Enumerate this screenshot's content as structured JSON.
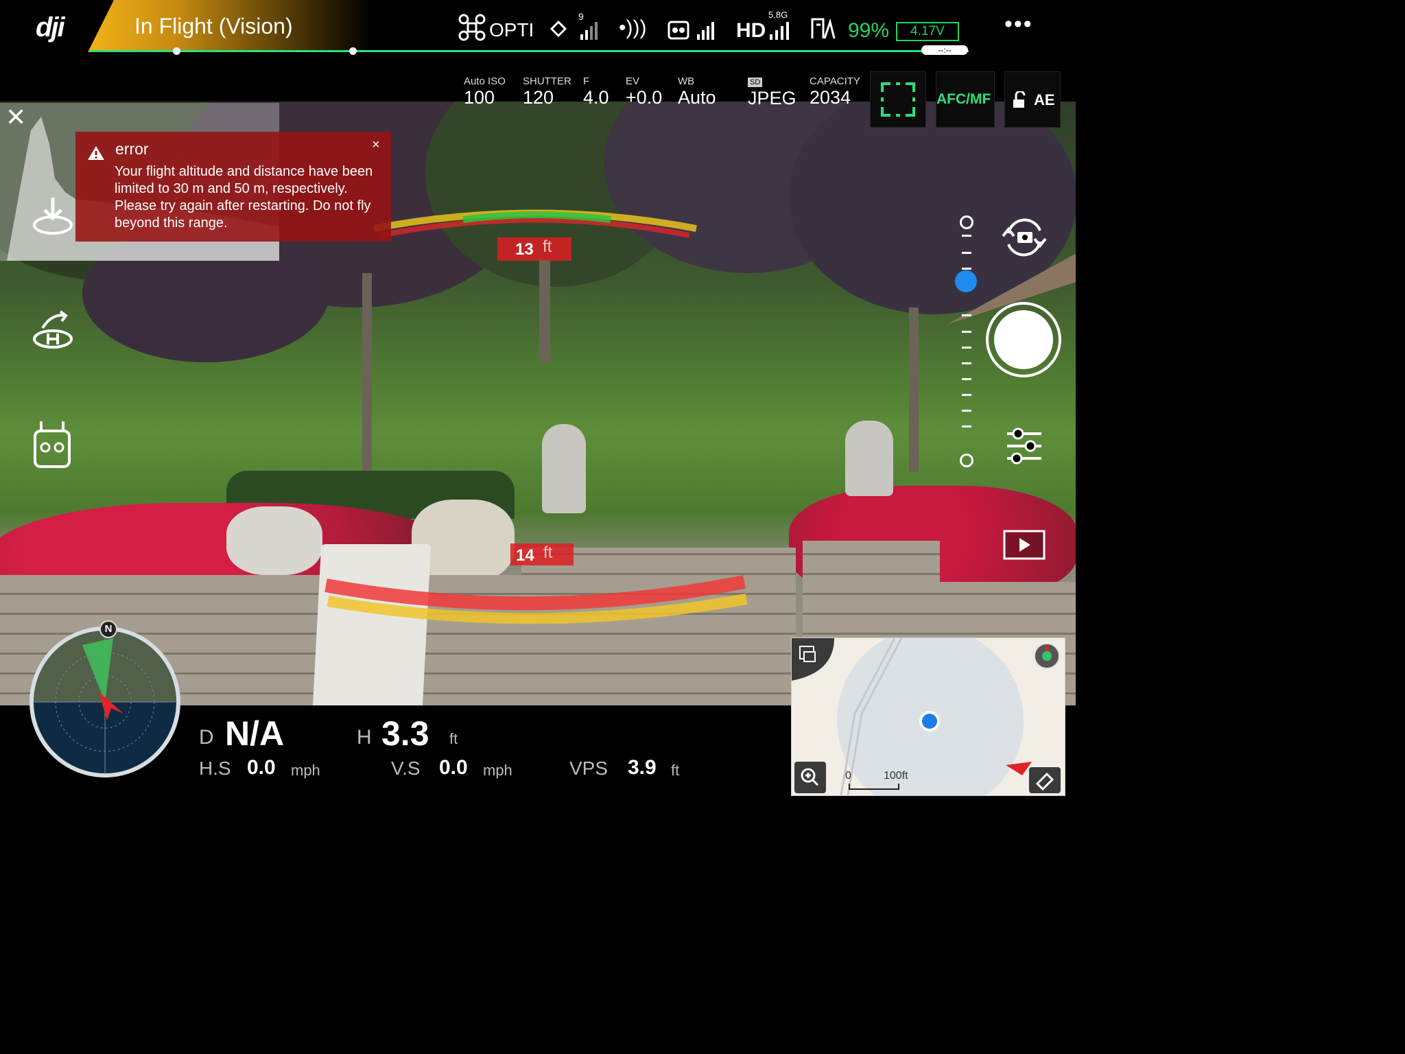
{
  "status": {
    "flight_mode": "In Flight (Vision)"
  },
  "top_icons": {
    "drone_mode": "OPTI",
    "gps_count": "9",
    "hd_band": "5.8G",
    "hd_label": "HD",
    "battery_percent": "99%",
    "battery_voltage": "4.17V",
    "timer": "--:--",
    "menu": "•••",
    "colors": {
      "battery": "#26d35f",
      "accent": "#2be07f"
    }
  },
  "camera_params": [
    {
      "label": "Auto ISO",
      "value": "100"
    },
    {
      "label": "SHUTTER",
      "value": "120"
    },
    {
      "label": "F",
      "value": "4.0"
    },
    {
      "label": "EV",
      "value": "+0.0"
    },
    {
      "label": "WB",
      "value": "Auto"
    },
    {
      "label": "SD",
      "value": "JPEG"
    },
    {
      "label": "CAPACITY",
      "value": "2034"
    }
  ],
  "focus": {
    "afc_mf": "AFC/MF",
    "ae": "AE"
  },
  "error": {
    "title": "error",
    "message": "Your flight altitude and distance have been limited to 30 m and 50 m, respectively. Please try again after restarting. Do not fly beyond this range.",
    "close": "×"
  },
  "obstacle": {
    "upper_distance": "13",
    "lower_distance": "14",
    "unit": "ft"
  },
  "compass": {
    "north": "N"
  },
  "telemetry": {
    "d_label": "D",
    "d_value": "N/A",
    "h_label": "H",
    "h_value": "3.3",
    "h_unit": "ft",
    "hs_label": "H.S",
    "hs_value": "0.0",
    "hs_unit": "mph",
    "vs_label": "V.S",
    "vs_value": "0.0",
    "vs_unit": "mph",
    "vps_label": "VPS",
    "vps_value": "3.9",
    "vps_unit": "ft"
  },
  "map": {
    "scale_zero": "0",
    "scale_label": "100ft"
  }
}
